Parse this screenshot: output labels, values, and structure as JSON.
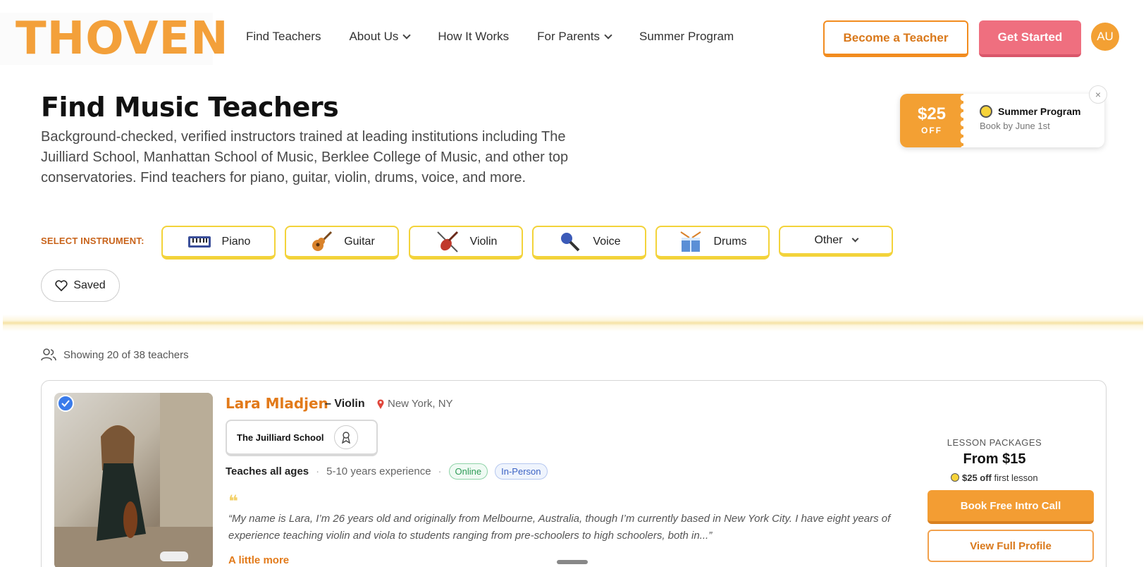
{
  "brand": {
    "logo": "THOVEN"
  },
  "nav": {
    "items": [
      {
        "label": "Find Teachers",
        "dropdown": false
      },
      {
        "label": "About Us",
        "dropdown": true
      },
      {
        "label": "How It Works",
        "dropdown": false
      },
      {
        "label": "For Parents",
        "dropdown": true
      },
      {
        "label": "Summer Program",
        "dropdown": false
      }
    ],
    "become_teacher": "Become a Teacher",
    "get_started": "Get Started",
    "avatar": "AU"
  },
  "hero": {
    "title": "Find Music Teachers",
    "subtitle": "Background-checked, verified instructors trained at leading institutions including The Juilliard School, Manhattan School of Music, Berklee College of Music, and other top conservatories. Find teachers for piano, guitar, violin, drums, voice, and more."
  },
  "promo": {
    "amount": "$25",
    "off": "OFF",
    "title": "Summer Program",
    "subtitle": "Book by June 1st",
    "close": "×"
  },
  "instruments": {
    "label": "SELECT INSTRUMENT:",
    "items": [
      {
        "label": "Piano",
        "icon": "piano-icon"
      },
      {
        "label": "Guitar",
        "icon": "guitar-icon"
      },
      {
        "label": "Violin",
        "icon": "violin-icon"
      },
      {
        "label": "Voice",
        "icon": "microphone-icon"
      },
      {
        "label": "Drums",
        "icon": "drum-icon"
      },
      {
        "label": "Other",
        "icon": "chevron-down-icon"
      }
    ],
    "saved": "Saved"
  },
  "results": {
    "showing": "Showing 20 of 38 teachers"
  },
  "teacher": {
    "name": "Lara Mladjen",
    "instrument": "– Violin",
    "location": "New York, NY",
    "school": "The Juilliard School",
    "ages": "Teaches all ages",
    "experience": "5-10 years experience",
    "tag_online": "Online",
    "tag_in_person": "In-Person",
    "quote": "“My name is Lara, I’m 26 years old and originally from Melbourne, Australia, though I’m currently based in New York City. I have eight years of experience teaching violin and viola to students ranging from pre-schoolers to high schoolers, both in...”",
    "more": "A little more",
    "packages_label": "LESSON PACKAGES",
    "price": "From $15",
    "discount_bold": "$25 off",
    "discount_rest": " first lesson",
    "book": "Book Free Intro Call",
    "view": "View Full Profile"
  },
  "colors": {
    "orange": "#f3a033",
    "pink": "#ef6f7f",
    "yellow": "#f3d33a",
    "blue": "#3a7bea"
  }
}
